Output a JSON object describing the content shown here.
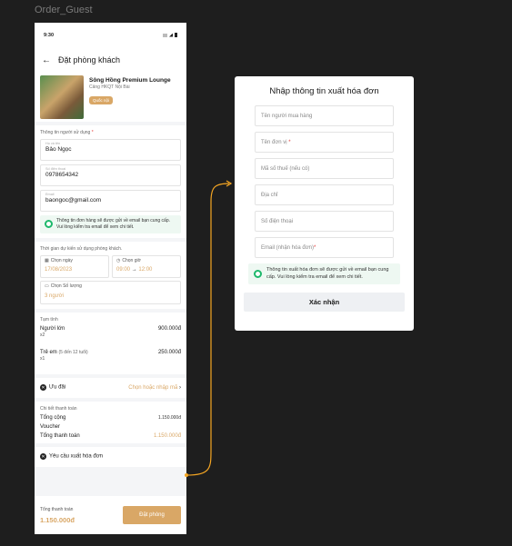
{
  "frame_label": "Order_Guest",
  "colors": {
    "accent": "#d9a766",
    "connector": "#f5a623",
    "success": "#1db86b"
  },
  "phone": {
    "status_time": "9:30",
    "header": {
      "back_icon": "arrow-left-icon",
      "title": "Đặt phòng khách"
    },
    "venue": {
      "name": "Sông Hồng Premium Lounge",
      "location": "Cảng HKQT Nội Bài",
      "badge": "Quốc nội"
    },
    "user_info": {
      "title": "Thông tin người sử dụng",
      "required_mark": "*",
      "fields": [
        {
          "label": "Họ và tên",
          "value": "Bảo Ngọc"
        },
        {
          "label": "Số điện thoại",
          "value": "0978654342"
        },
        {
          "label": "Email",
          "value": "baongoc@gmail.com"
        }
      ],
      "note": "Thông tin đơn hàng sẽ được gửi về email bạn cung cấp. Vui lòng kiểm tra email để xem chi tiết."
    },
    "time": {
      "title": "Thời gian dự kiến sử dụng phòng khách.",
      "date_label": "Chọn ngày",
      "date_value": "17/08/2023",
      "time_label": "Chọn giờ",
      "time_from": "09:00",
      "arrow": "→",
      "time_to": "12:00",
      "qty_label": "Chọn Số lượng",
      "qty_value": "3 người"
    },
    "subtotal": {
      "title": "Tạm tính",
      "lines": [
        {
          "label": "Người lớn",
          "note": "",
          "qty": "x2",
          "amount": "900.000đ"
        },
        {
          "label": "Trẻ em",
          "note": "(5 đến 12 tuổi)",
          "qty": "x1",
          "amount": "250.000đ"
        }
      ]
    },
    "discount": {
      "label": "Ưu đãi",
      "action": "Chọn hoặc nhập mã",
      "chevron": "›"
    },
    "payment": {
      "title": "Chi tiết thanh toán",
      "total_label": "Tổng cộng",
      "total_value": "1.150.000đ",
      "voucher_label": "Voucher",
      "grand_label": "Tổng thanh toán",
      "grand_value": "1.150.000đ"
    },
    "invoice": {
      "label": "Yêu cầu xuất hóa đơn"
    },
    "footer": {
      "total_label": "Tổng thanh toán",
      "total_value": "1.150.000đ",
      "book_button": "Đặt phòng"
    }
  },
  "modal": {
    "title": "Nhập thông tin xuất hóa đơn",
    "fields": [
      {
        "placeholder": "Tên người mua hàng",
        "required": ""
      },
      {
        "placeholder": "Tên đơn vị",
        "required": "*"
      },
      {
        "placeholder": "Mã số thuế (nếu có)",
        "required": ""
      },
      {
        "placeholder": "Địa chỉ",
        "required": ""
      },
      {
        "placeholder": "Số điện thoại",
        "required": ""
      },
      {
        "placeholder": "Email (nhận hóa đơn)",
        "required": "*"
      }
    ],
    "note": "Thông tin xuất hóa đơn sẽ được gửi về email bạn cung cấp. Vui lòng kiểm tra email để xem chi tiết.",
    "confirm_button": "Xác nhận"
  }
}
